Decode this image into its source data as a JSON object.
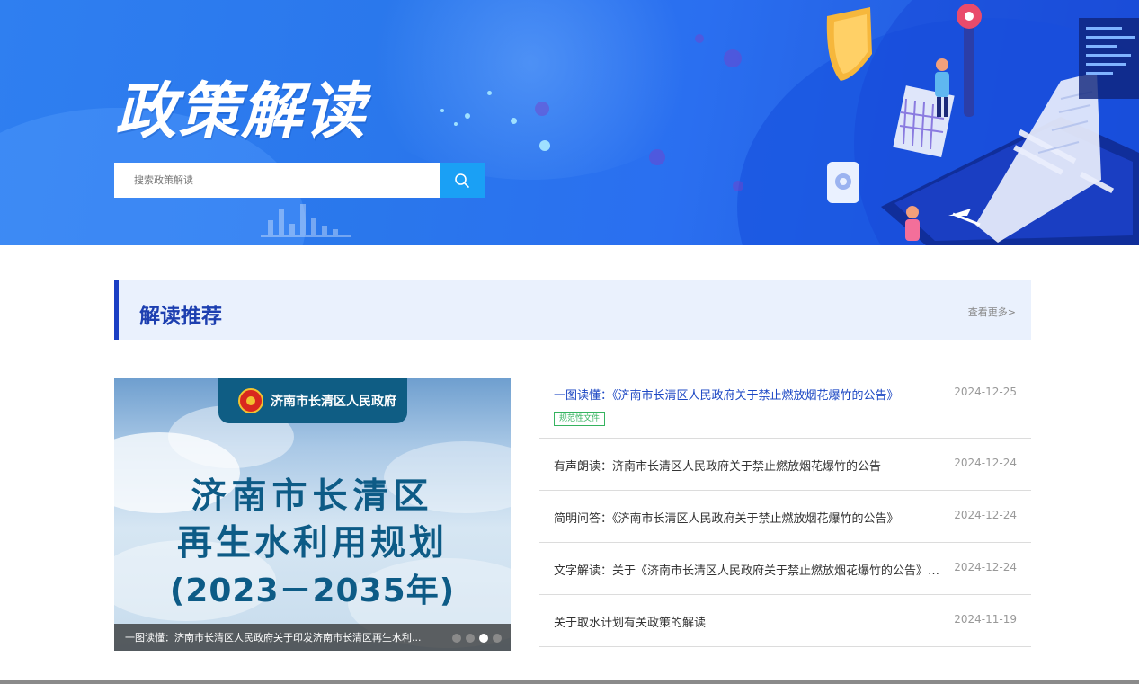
{
  "banner": {
    "title": "政策解读",
    "search_placeholder": "搜索政策解读",
    "search_icon": "search-icon"
  },
  "section": {
    "title": "解读推荐",
    "more_link": "查看更多>"
  },
  "carousel": {
    "poster": {
      "issuer": "济南市长清区人民政府",
      "line1": "济南市长清区",
      "line2": "再生水利用规划",
      "line3": "(2023－2035年)"
    },
    "caption": "一图读懂：济南市长清区人民政府关于印发济南市长清区再生水利...",
    "slides_total": 4,
    "active_slide": 3
  },
  "news": [
    {
      "title": "一图读懂：《济南市长清区人民政府关于禁止燃放烟花爆竹的公告》",
      "date": "2024-12-25",
      "tag": "规范性文件",
      "highlighted": true
    },
    {
      "title": "有声朗读：济南市长清区人民政府关于禁止燃放烟花爆竹的公告",
      "date": "2024-12-24"
    },
    {
      "title": "简明问答：《济南市长清区人民政府关于禁止燃放烟花爆竹的公告》",
      "date": "2024-12-24"
    },
    {
      "title": "文字解读：关于《济南市长清区人民政府关于禁止燃放烟花爆竹的公告》的...",
      "date": "2024-12-24"
    },
    {
      "title": "关于取水计划有关政策的解读",
      "date": "2024-11-19"
    }
  ],
  "colors": {
    "banner_blue": "#2f7ff0",
    "search_button": "#1aa0f5",
    "section_accent": "#1a3fc4",
    "section_bg": "#eaf1fd",
    "highlight_title": "#1d48c4",
    "tag_green": "#35b35f"
  }
}
